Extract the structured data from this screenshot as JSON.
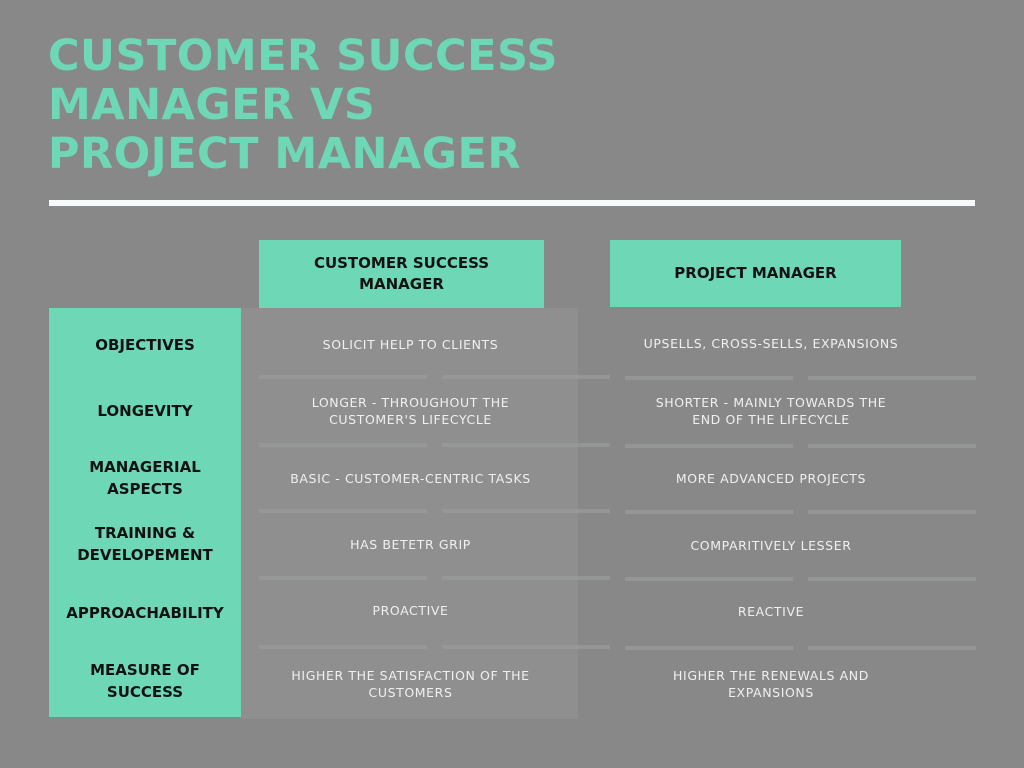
{
  "title": {
    "lines": [
      "CUSTOMER SUCCESS",
      "MANAGER VS",
      "PROJECT MANAGER"
    ]
  },
  "colors": {
    "background": "#888888",
    "accent": "#6ed8b6",
    "rule": "#f7fafa",
    "cell_text": "#f0f0f0",
    "header_text": "#111111"
  },
  "columns": {
    "csm": "CUSTOMER SUCCESS MANAGER",
    "pm": "PROJECT MANAGER"
  },
  "rows": [
    {
      "label": "OBJECTIVES",
      "csm": "SOLICIT HELP TO CLIENTS",
      "pm": "UPSELLS, CROSS-SELLS, EXPANSIONS"
    },
    {
      "label": "LONGEVITY",
      "csm": "LONGER - THROUGHOUT THE CUSTOMER'S LIFECYCLE",
      "pm": "SHORTER - MAINLY TOWARDS THE END OF THE LIFECYCLE"
    },
    {
      "label": "MANAGERIAL ASPECTS",
      "csm": "BASIC - CUSTOMER-CENTRIC TASKS",
      "pm": "MORE ADVANCED PROJECTS"
    },
    {
      "label": "TRAINING & DEVELOPEMENT",
      "csm": "HAS BETETR GRIP",
      "pm": "COMPARITIVELY LESSER"
    },
    {
      "label": "APPROACHABILITY",
      "csm": "PROACTIVE",
      "pm": "REACTIVE"
    },
    {
      "label": "MEASURE OF SUCCESS",
      "csm": "HIGHER THE SATISFACTION OF THE CUSTOMERS",
      "pm": "HIGHER THE RENEWALS AND EXPANSIONS"
    }
  ]
}
